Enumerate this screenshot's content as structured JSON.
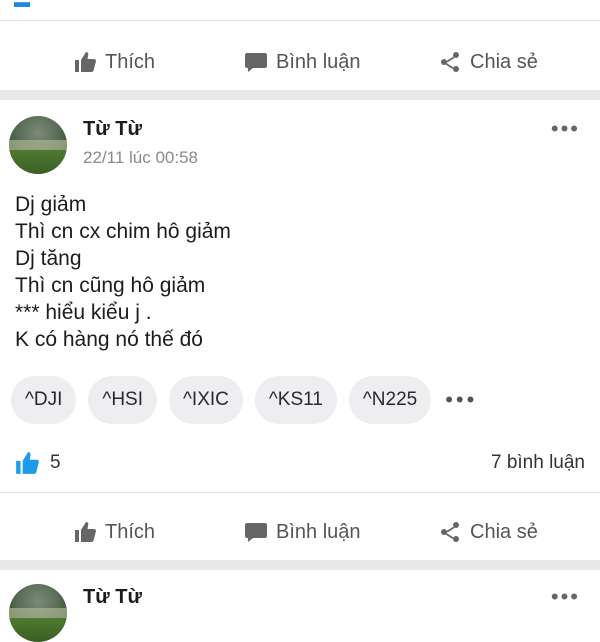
{
  "post_actions": {
    "like": "Thích",
    "comment": "Bình luận",
    "share": "Chia sẻ"
  },
  "post": {
    "author": "Từ Từ",
    "timestamp": "22/11 lúc 00:58",
    "lines": [
      "Dj giảm",
      "Thì cn cx chim hô giảm",
      "Dj tăng",
      "Thì cn cũng hô giảm",
      "*** hiểu kiểu j .",
      "K có hàng nó thế đó"
    ],
    "tags": [
      "^DJI",
      "^HSI",
      "^IXIC",
      "^KS11",
      "^N225"
    ],
    "like_count": "5",
    "comment_count": "7 bình luận"
  },
  "next_post": {
    "author": "Từ Từ"
  },
  "colors": {
    "accent_like": "#1e9be9",
    "separator": "#e8e8ea"
  }
}
